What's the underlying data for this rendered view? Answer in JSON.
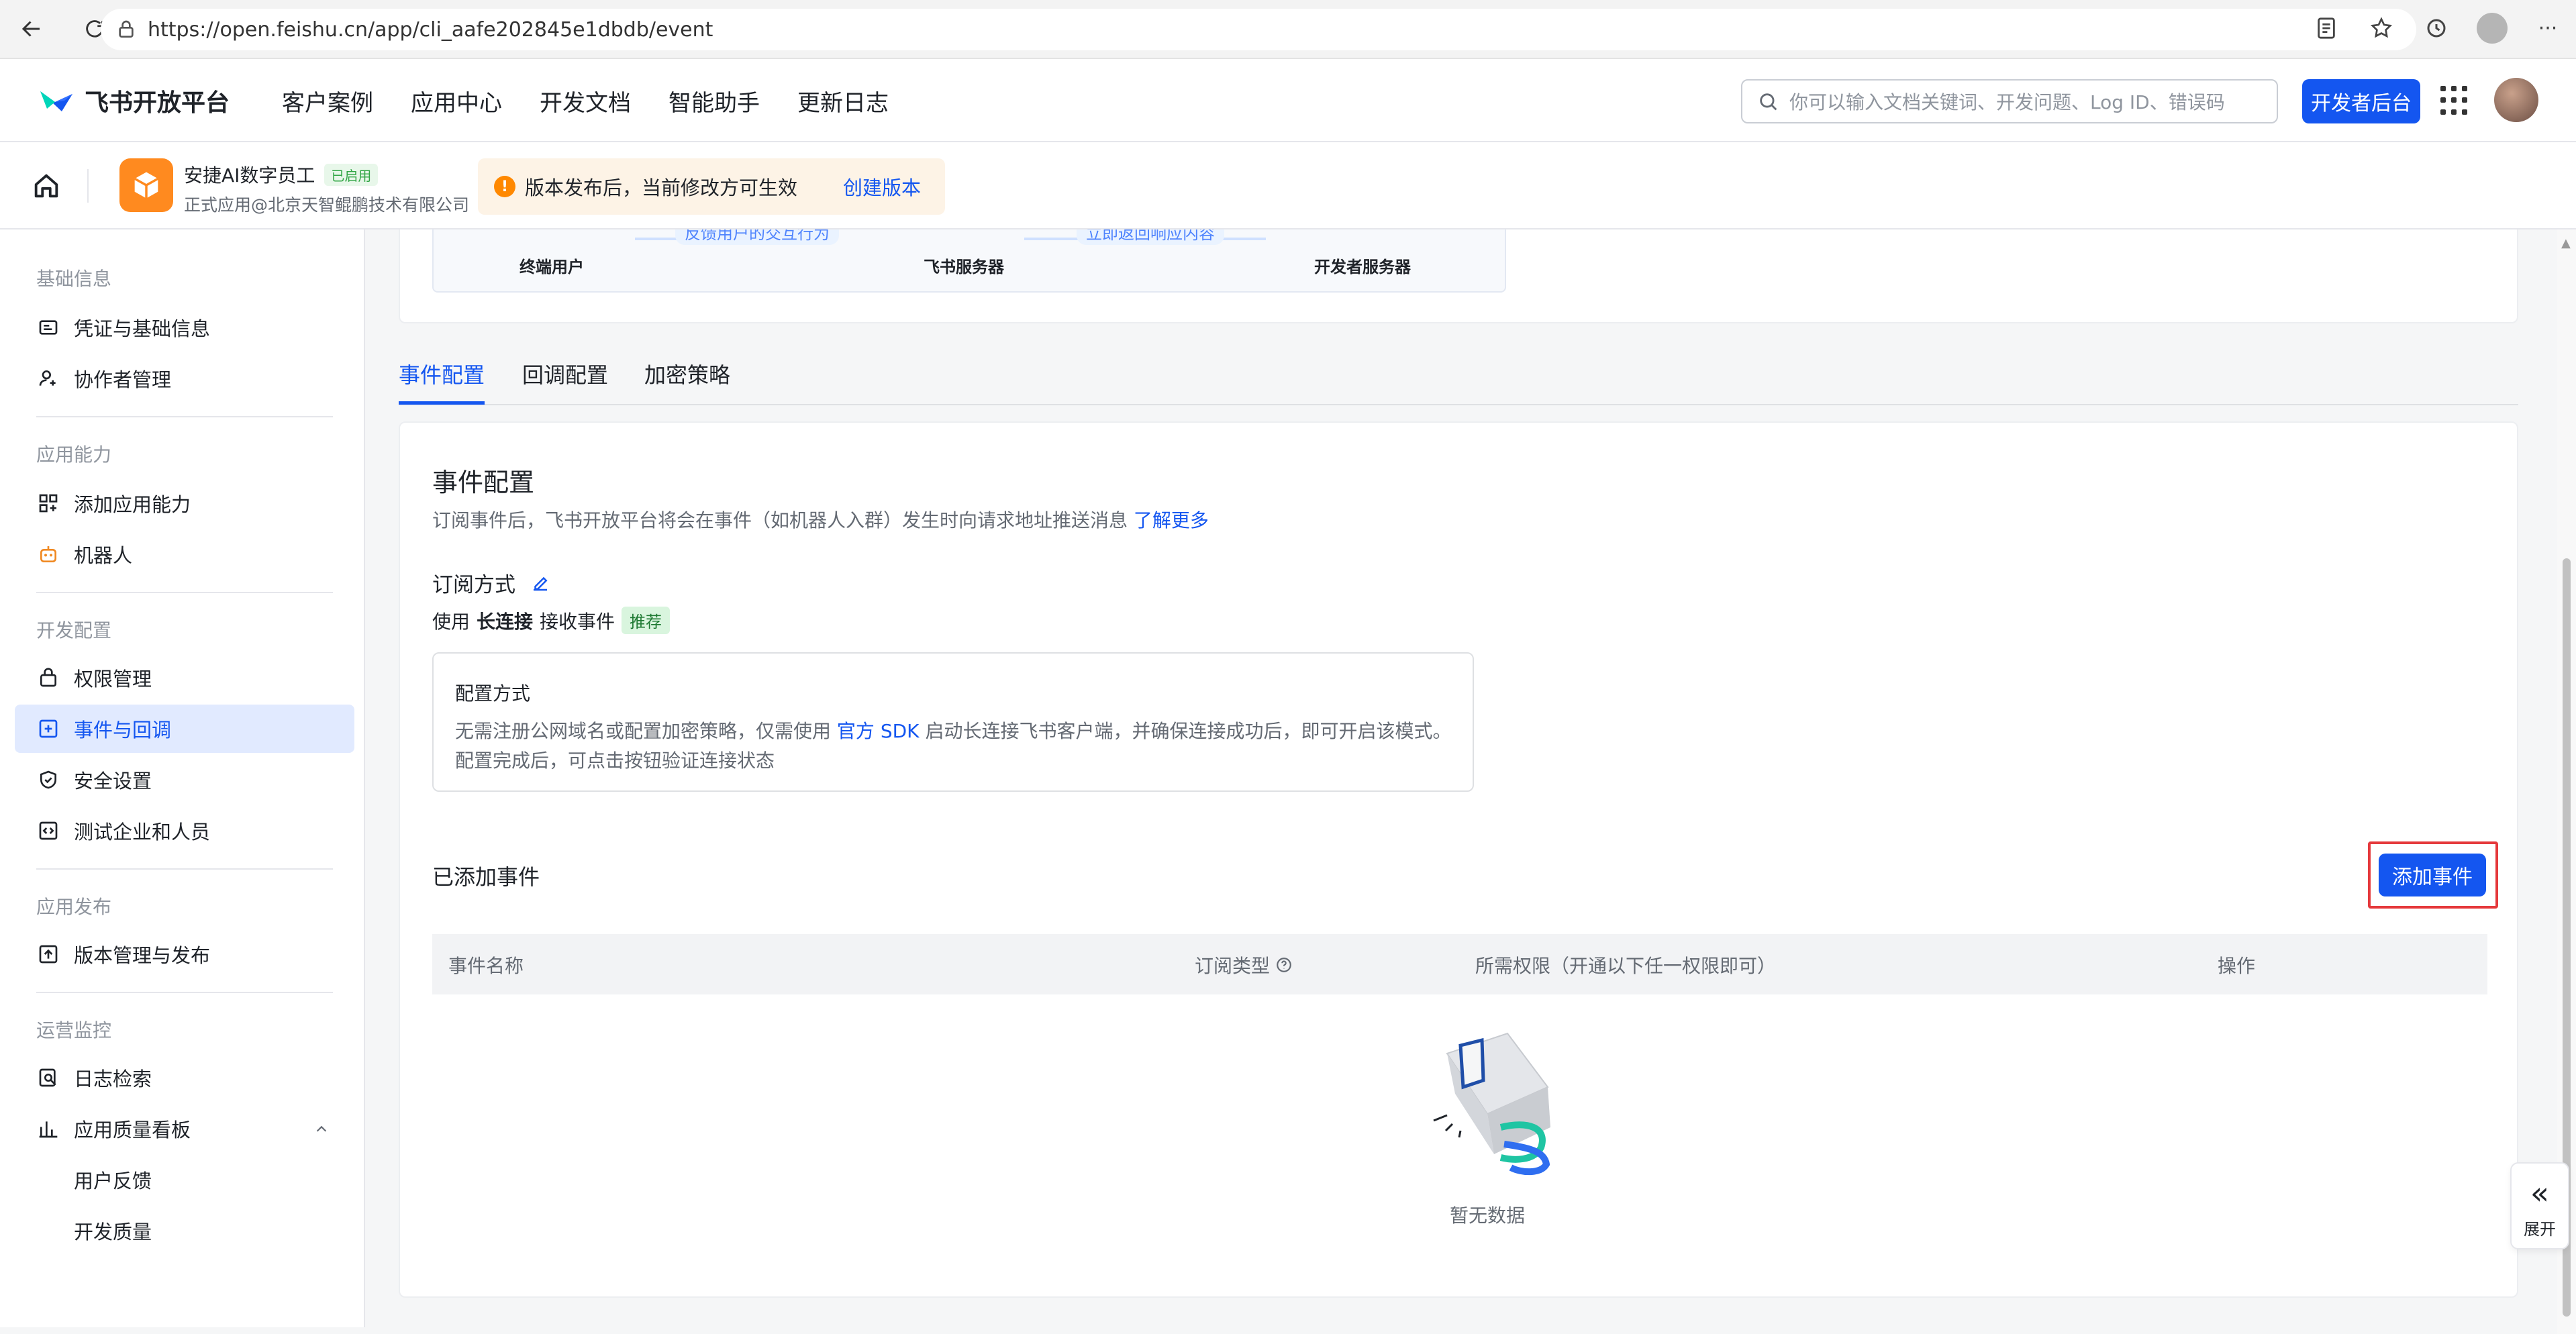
{
  "browser": {
    "url": "https://open.feishu.cn/app/cli_aafe202845e1dbdb/event"
  },
  "topnav": {
    "brand": "飞书开放平台",
    "links": [
      "客户案例",
      "应用中心",
      "开发文档",
      "智能助手",
      "更新日志"
    ],
    "search_placeholder": "你可以输入文档关键词、开发问题、Log ID、错误码",
    "dev_console": "开发者后台"
  },
  "app": {
    "name": "安捷AI数字员工",
    "status_badge": "已启用",
    "subtitle": "正式应用@北京天智鲲鹏技术有限公司",
    "notice": "版本发布后，当前修改方可生效",
    "create_version": "创建版本"
  },
  "sidebar": {
    "groups": {
      "basic": "基础信息",
      "ability": "应用能力",
      "dev": "开发配置",
      "publish": "应用发布",
      "ops": "运营监控"
    },
    "items": {
      "credentials": "凭证与基础信息",
      "collaborators": "协作者管理",
      "add_ability": "添加应用能力",
      "bot": "机器人",
      "permissions": "权限管理",
      "events": "事件与回调",
      "security": "安全设置",
      "test_org": "测试企业和人员",
      "versions": "版本管理与发布",
      "logs": "日志检索",
      "quality": "应用质量看板",
      "feedback": "用户反馈",
      "dev_quality": "开发质量"
    }
  },
  "diagram": {
    "end_user": "终端用户",
    "feishu_server": "飞书服务器",
    "dev_server": "开发者服务器",
    "arrow1": "反馈用户的交互行为",
    "arrow2": "立即返回响应内容"
  },
  "tabs": {
    "event_config": "事件配置",
    "callback_config": "回调配置",
    "encrypt": "加密策略"
  },
  "event_section": {
    "title": "事件配置",
    "desc": "订阅事件后，飞书开放平台将会在事件（如机器人入群）发生时向请求地址推送消息",
    "learn_more": "了解更多",
    "subscribe_title": "订阅方式",
    "use_prefix": "使用",
    "use_bold": "长连接",
    "use_suffix": "接收事件",
    "recommended": "推荐",
    "config_title": "配置方式",
    "config_line1_a": "无需注册公网域名或配置加密策略，仅需使用",
    "config_line1_link": "官方 SDK",
    "config_line1_b": "启动长连接飞书客户端，并确保连接成功后，即可开启该模式。",
    "config_line2": "配置完成后，可点击按钮验证连接状态"
  },
  "added_events": {
    "title": "已添加事件",
    "add_button": "添加事件",
    "columns": [
      "事件名称",
      "订阅类型",
      "所需权限（开通以下任一权限即可）",
      "操作"
    ],
    "empty_text": "暂无数据"
  },
  "float": {
    "expand": "展开"
  }
}
